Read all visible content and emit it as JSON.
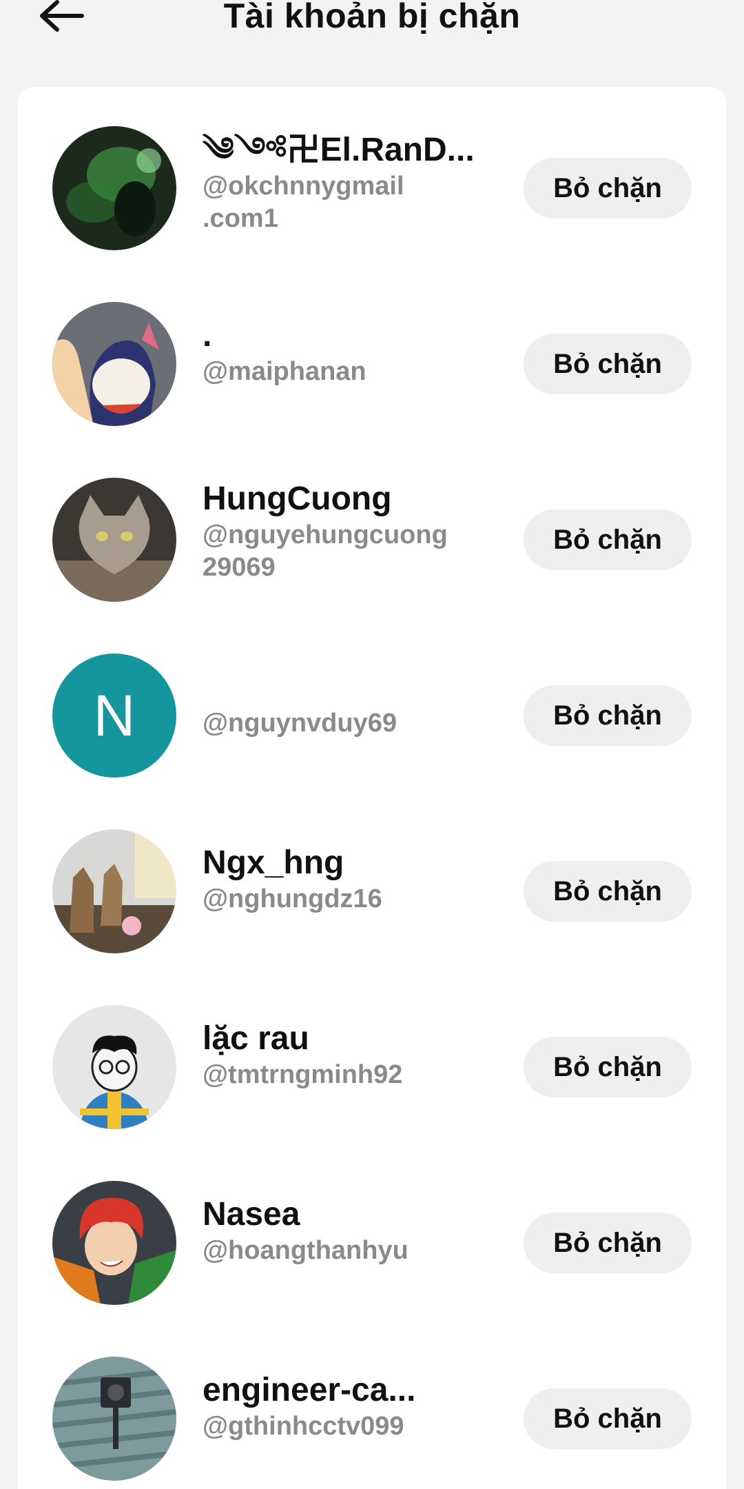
{
  "header": {
    "title": "Tài khoản bị chặn"
  },
  "unblock_label": "Bỏ chặn",
  "accounts": [
    {
      "name": "༄༺卍El.RanD...",
      "handle": "@okchnnygmail .com1"
    },
    {
      "name": ".",
      "handle": "@maiphanan"
    },
    {
      "name": "HungCuong",
      "handle": "@nguyehungcuong 29069"
    },
    {
      "name": "",
      "handle": "@nguynvduy69",
      "avatar_letter": "N",
      "avatar_color": "#15959e"
    },
    {
      "name": "Ngx_hng",
      "handle": "@nghungdz16"
    },
    {
      "name": "lặc rau",
      "handle": "@tmtrngminh92"
    },
    {
      "name": "Nasea",
      "handle": "@hoangthanhyu"
    },
    {
      "name": "engineer-ca...",
      "handle": "@gthinhcctv099"
    }
  ]
}
